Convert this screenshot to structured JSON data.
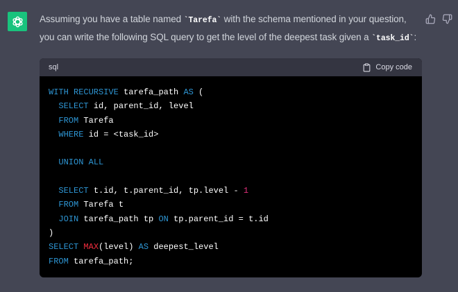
{
  "message": {
    "line1_prefix": "Assuming you have a table named ",
    "line1_code": "`Tarefa`",
    "line1_suffix": " with the schema mentioned in your question,",
    "line2_prefix": "you can write the following SQL query to get the level of the deepest task given a ",
    "line2_code": "`task_id`",
    "line2_suffix": ":"
  },
  "code_block": {
    "language": "sql",
    "copy_label": "Copy code",
    "lines": [
      [
        {
          "t": "WITH RECURSIVE",
          "c": "kw"
        },
        {
          "t": " tarefa_path ",
          "c": "plain"
        },
        {
          "t": "AS",
          "c": "kw"
        },
        {
          "t": " (",
          "c": "plain"
        }
      ],
      [
        {
          "t": "  ",
          "c": "plain"
        },
        {
          "t": "SELECT",
          "c": "kw"
        },
        {
          "t": " id, parent_id, level",
          "c": "plain"
        }
      ],
      [
        {
          "t": "  ",
          "c": "plain"
        },
        {
          "t": "FROM",
          "c": "kw"
        },
        {
          "t": " Tarefa",
          "c": "plain"
        }
      ],
      [
        {
          "t": "  ",
          "c": "plain"
        },
        {
          "t": "WHERE",
          "c": "kw"
        },
        {
          "t": " id = <task_id>",
          "c": "plain"
        }
      ],
      [],
      [
        {
          "t": "  ",
          "c": "plain"
        },
        {
          "t": "UNION ALL",
          "c": "kw"
        }
      ],
      [],
      [
        {
          "t": "  ",
          "c": "plain"
        },
        {
          "t": "SELECT",
          "c": "kw"
        },
        {
          "t": " t.id, t.parent_id, tp.level - ",
          "c": "plain"
        },
        {
          "t": "1",
          "c": "num"
        }
      ],
      [
        {
          "t": "  ",
          "c": "plain"
        },
        {
          "t": "FROM",
          "c": "kw"
        },
        {
          "t": " Tarefa t",
          "c": "plain"
        }
      ],
      [
        {
          "t": "  ",
          "c": "plain"
        },
        {
          "t": "JOIN",
          "c": "kw"
        },
        {
          "t": " tarefa_path tp ",
          "c": "plain"
        },
        {
          "t": "ON",
          "c": "kw"
        },
        {
          "t": " tp.parent_id = t.id",
          "c": "plain"
        }
      ],
      [
        {
          "t": ")",
          "c": "plain"
        }
      ],
      [
        {
          "t": "SELECT",
          "c": "kw"
        },
        {
          "t": " ",
          "c": "plain"
        },
        {
          "t": "MAX",
          "c": "fn"
        },
        {
          "t": "(level) ",
          "c": "plain"
        },
        {
          "t": "AS",
          "c": "kw"
        },
        {
          "t": " deepest_level",
          "c": "plain"
        }
      ],
      [
        {
          "t": "FROM",
          "c": "kw"
        },
        {
          "t": " tarefa_path;",
          "c": "plain"
        }
      ]
    ]
  },
  "colors": {
    "background": "#444654",
    "avatar": "#19c37d",
    "code_header": "#343541",
    "code_bg": "#000000",
    "keyword": "#2e95d3",
    "function": "#f22c3d",
    "number": "#df3079"
  },
  "icons": {
    "avatar": "openai-logo-icon",
    "thumbs_up": "thumbs-up-icon",
    "thumbs_down": "thumbs-down-icon",
    "copy": "clipboard-icon"
  }
}
